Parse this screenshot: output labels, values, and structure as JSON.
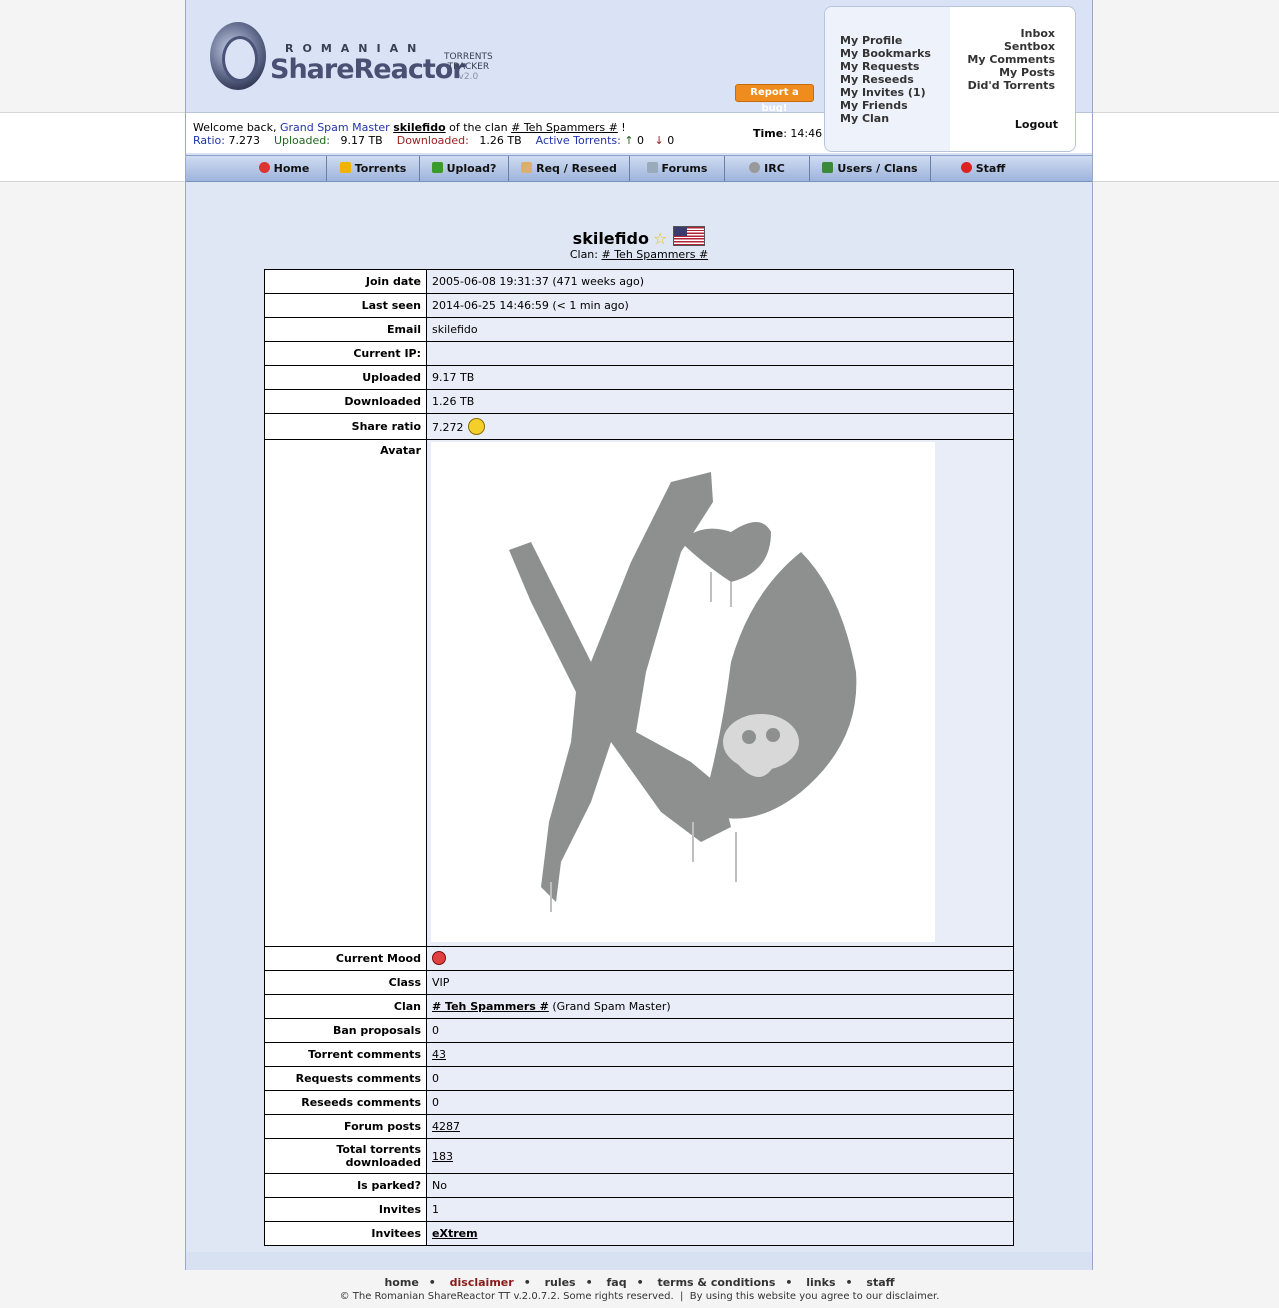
{
  "logo": {
    "romanian": "ROMANIAN",
    "brand": "ShareReactor",
    "tracker1": "TORRENTS",
    "tracker2": "TRACKER",
    "version": "v2.0"
  },
  "report_bug": "Report a bug!",
  "user_menu": {
    "left": [
      "My Profile",
      "My Bookmarks",
      "My Requests",
      "My Reseeds",
      "My Invites (1)",
      "My Friends",
      "My Clan"
    ],
    "right": [
      "Inbox",
      "Sentbox",
      "My Comments",
      "My Posts",
      "Did'd Torrents"
    ],
    "logout": "Logout"
  },
  "welcome": {
    "prefix": "Welcome back,",
    "rank": "Grand Spam Master",
    "username": "skilefido",
    "of_clan": "of the clan",
    "clan": "# Teh Spammers #",
    "suffix": "!",
    "ratio_label": "Ratio:",
    "ratio": "7.273",
    "uploaded_label": "Uploaded:",
    "uploaded": "9.17 TB",
    "downloaded_label": "Downloaded:",
    "downloaded": "1.26 TB",
    "active_label": "Active Torrents:",
    "active_up": "0",
    "active_down": "0",
    "time_label": "Time",
    "time": "14:46"
  },
  "nav": [
    "Home",
    "Torrents",
    "Upload?",
    "Req / Reseed",
    "Forums",
    "IRC",
    "Users / Clans",
    "Staff"
  ],
  "profile": {
    "username": "skilefido",
    "clan_label": "Clan:",
    "clan": "# Teh Spammers #"
  },
  "rows": {
    "join_date": {
      "label": "Join date",
      "value": "2005-06-08 19:31:37 (471 weeks ago)"
    },
    "last_seen": {
      "label": "Last seen",
      "value": "2014-06-25 14:46:59 (< 1 min ago)"
    },
    "email": {
      "label": "Email",
      "value": "skilefido"
    },
    "current_ip": {
      "label": "Current IP:",
      "value": ""
    },
    "uploaded": {
      "label": "Uploaded",
      "value": "9.17 TB"
    },
    "downloaded": {
      "label": "Downloaded",
      "value": "1.26 TB"
    },
    "share_ratio": {
      "label": "Share ratio",
      "value": "7.272"
    },
    "avatar": {
      "label": "Avatar"
    },
    "current_mood": {
      "label": "Current Mood"
    },
    "class": {
      "label": "Class",
      "value": "VIP"
    },
    "clan": {
      "label": "Clan",
      "value": "# Teh Spammers #",
      "extra": "(Grand Spam Master)"
    },
    "ban_proposals": {
      "label": "Ban proposals",
      "value": "0"
    },
    "torrent_comments": {
      "label": "Torrent comments",
      "value": "43"
    },
    "requests_comments": {
      "label": "Requests comments",
      "value": "0"
    },
    "reseeds_comments": {
      "label": "Reseeds comments",
      "value": "0"
    },
    "forum_posts": {
      "label": "Forum posts",
      "value": "4287"
    },
    "total_downloaded": {
      "label": "Total torrents downloaded",
      "value": "183"
    },
    "is_parked": {
      "label": "Is parked?",
      "value": "No"
    },
    "invites": {
      "label": "Invites",
      "value": "1"
    },
    "invitees": {
      "label": "Invitees",
      "value": "eXtrem"
    }
  },
  "footer": {
    "links": [
      "home",
      "disclaimer",
      "rules",
      "faq",
      "terms & conditions",
      "links",
      "staff"
    ],
    "copyright": "© The Romanian ShareReactor TT v.2.0.7.2. Some rights reserved.",
    "separator": "|",
    "agree": "By using this website you agree to our disclaimer."
  },
  "colors": {
    "accent_blue": "#2233aa",
    "uploaded_green": "#226622",
    "downloaded_red": "#992222",
    "report_orange": "#ef8c1d"
  }
}
